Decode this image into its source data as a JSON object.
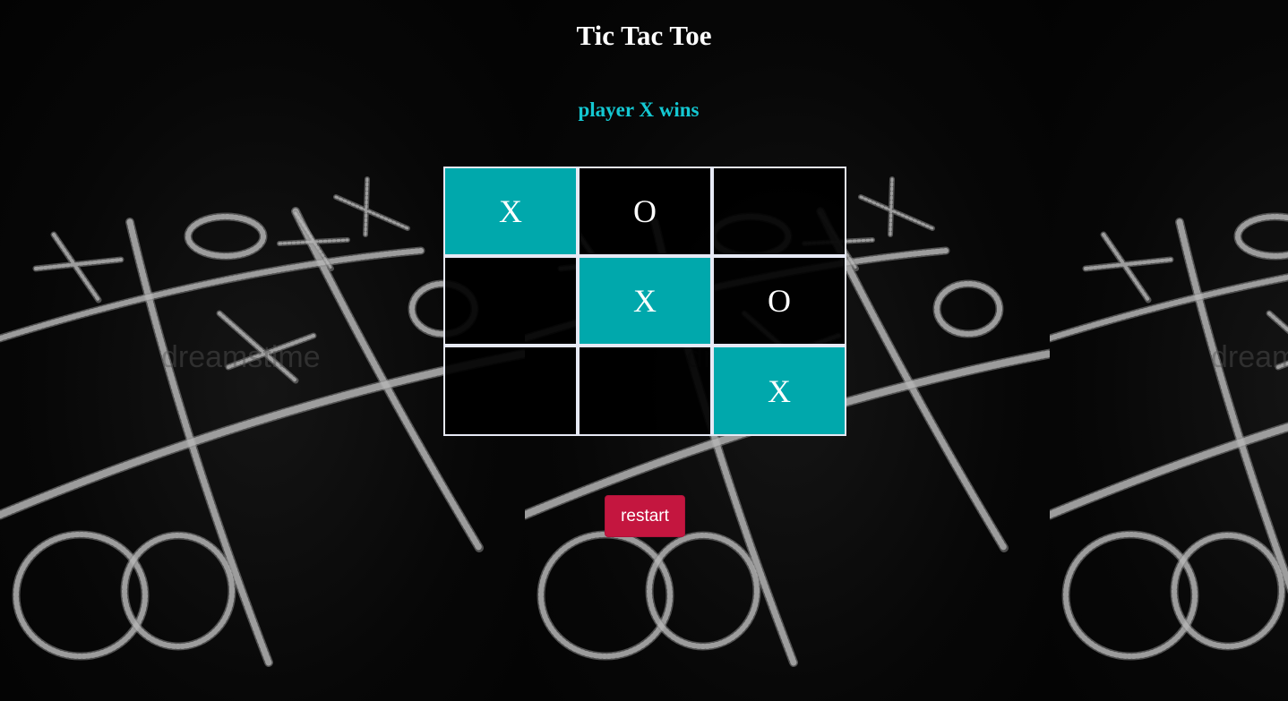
{
  "game": {
    "title": "Tic Tac Toe",
    "status": "player X wins",
    "board": [
      "X",
      "O",
      "",
      "",
      "X",
      "O",
      "",
      "",
      "X"
    ],
    "winning_line": [
      0,
      4,
      8
    ],
    "restart_label": "restart"
  },
  "background": {
    "watermark": "dreamstime"
  },
  "colors": {
    "status": "#14c8d2",
    "win_cell": "#00a8ac",
    "cell_border": "#e6e9f5",
    "restart_button": "#c4163f"
  }
}
